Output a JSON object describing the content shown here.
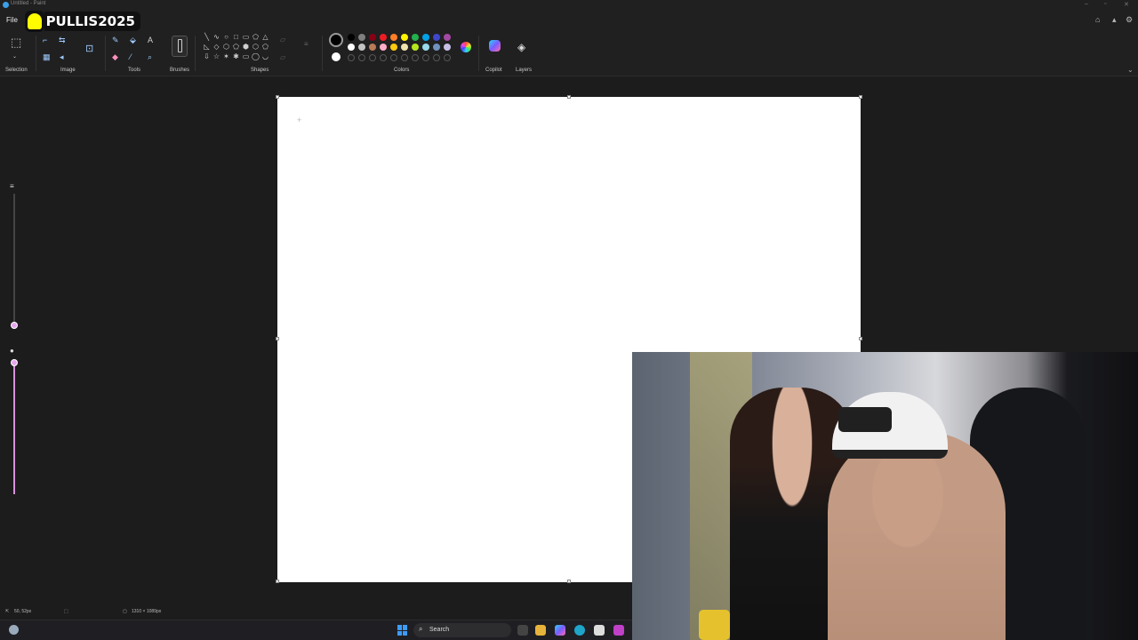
{
  "window": {
    "title": "Untitled - Paint"
  },
  "menu": {
    "file": "File"
  },
  "overlay": {
    "username": "PULLIS2025"
  },
  "ribbon": {
    "groups": {
      "selection": "Selection",
      "image": "Image",
      "tools": "Tools",
      "brushes": "Brushes",
      "shapes": "Shapes",
      "colors": "Colors",
      "copilot": "Copilot",
      "layers": "Layers"
    },
    "shape_glyphs": [
      "╲",
      "∿",
      "○",
      "□",
      "▭",
      "⬠",
      "△",
      "◺",
      "◇",
      "⬡",
      "⬠",
      "⬢",
      "⬡",
      "⬠",
      "⇩",
      "☆",
      "✶",
      "✱",
      "▭",
      "◯",
      "◡"
    ],
    "palette_row1": [
      "#000000",
      "#7f7f7f",
      "#880015",
      "#ed1c24",
      "#ff7f27",
      "#fff200",
      "#22b14c",
      "#00a2e8",
      "#3f48cc",
      "#a349a4"
    ],
    "palette_row2": [
      "#ffffff",
      "#c3c3c3",
      "#b97a57",
      "#ffaec9",
      "#ffc90e",
      "#efe4b0",
      "#b5e61d",
      "#99d9ea",
      "#7092be",
      "#c8bfe7"
    ],
    "primary_color": "#000000",
    "secondary_color": "#ffffff"
  },
  "statusbar": {
    "cursor_position": "50, 52px",
    "canvas_size": "1310 × 1089px"
  },
  "taskbar": {
    "search_label": "Search"
  }
}
